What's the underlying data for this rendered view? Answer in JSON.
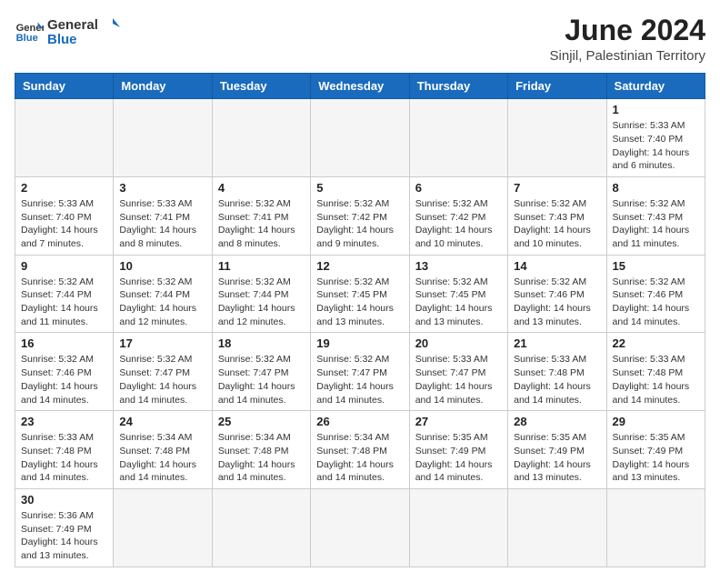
{
  "logo": {
    "text_general": "General",
    "text_blue": "Blue"
  },
  "title": {
    "month_year": "June 2024",
    "location": "Sinjil, Palestinian Territory"
  },
  "days_of_week": [
    "Sunday",
    "Monday",
    "Tuesday",
    "Wednesday",
    "Thursday",
    "Friday",
    "Saturday"
  ],
  "weeks": [
    [
      {
        "day": "",
        "info": ""
      },
      {
        "day": "",
        "info": ""
      },
      {
        "day": "",
        "info": ""
      },
      {
        "day": "",
        "info": ""
      },
      {
        "day": "",
        "info": ""
      },
      {
        "day": "",
        "info": ""
      },
      {
        "day": "1",
        "info": "Sunrise: 5:33 AM\nSunset: 7:40 PM\nDaylight: 14 hours\nand 6 minutes."
      }
    ],
    [
      {
        "day": "2",
        "info": "Sunrise: 5:33 AM\nSunset: 7:40 PM\nDaylight: 14 hours\nand 7 minutes."
      },
      {
        "day": "3",
        "info": "Sunrise: 5:33 AM\nSunset: 7:41 PM\nDaylight: 14 hours\nand 8 minutes."
      },
      {
        "day": "4",
        "info": "Sunrise: 5:32 AM\nSunset: 7:41 PM\nDaylight: 14 hours\nand 8 minutes."
      },
      {
        "day": "5",
        "info": "Sunrise: 5:32 AM\nSunset: 7:42 PM\nDaylight: 14 hours\nand 9 minutes."
      },
      {
        "day": "6",
        "info": "Sunrise: 5:32 AM\nSunset: 7:42 PM\nDaylight: 14 hours\nand 10 minutes."
      },
      {
        "day": "7",
        "info": "Sunrise: 5:32 AM\nSunset: 7:43 PM\nDaylight: 14 hours\nand 10 minutes."
      },
      {
        "day": "8",
        "info": "Sunrise: 5:32 AM\nSunset: 7:43 PM\nDaylight: 14 hours\nand 11 minutes."
      }
    ],
    [
      {
        "day": "9",
        "info": "Sunrise: 5:32 AM\nSunset: 7:44 PM\nDaylight: 14 hours\nand 11 minutes."
      },
      {
        "day": "10",
        "info": "Sunrise: 5:32 AM\nSunset: 7:44 PM\nDaylight: 14 hours\nand 12 minutes."
      },
      {
        "day": "11",
        "info": "Sunrise: 5:32 AM\nSunset: 7:44 PM\nDaylight: 14 hours\nand 12 minutes."
      },
      {
        "day": "12",
        "info": "Sunrise: 5:32 AM\nSunset: 7:45 PM\nDaylight: 14 hours\nand 13 minutes."
      },
      {
        "day": "13",
        "info": "Sunrise: 5:32 AM\nSunset: 7:45 PM\nDaylight: 14 hours\nand 13 minutes."
      },
      {
        "day": "14",
        "info": "Sunrise: 5:32 AM\nSunset: 7:46 PM\nDaylight: 14 hours\nand 13 minutes."
      },
      {
        "day": "15",
        "info": "Sunrise: 5:32 AM\nSunset: 7:46 PM\nDaylight: 14 hours\nand 14 minutes."
      }
    ],
    [
      {
        "day": "16",
        "info": "Sunrise: 5:32 AM\nSunset: 7:46 PM\nDaylight: 14 hours\nand 14 minutes."
      },
      {
        "day": "17",
        "info": "Sunrise: 5:32 AM\nSunset: 7:47 PM\nDaylight: 14 hours\nand 14 minutes."
      },
      {
        "day": "18",
        "info": "Sunrise: 5:32 AM\nSunset: 7:47 PM\nDaylight: 14 hours\nand 14 minutes."
      },
      {
        "day": "19",
        "info": "Sunrise: 5:32 AM\nSunset: 7:47 PM\nDaylight: 14 hours\nand 14 minutes."
      },
      {
        "day": "20",
        "info": "Sunrise: 5:33 AM\nSunset: 7:47 PM\nDaylight: 14 hours\nand 14 minutes."
      },
      {
        "day": "21",
        "info": "Sunrise: 5:33 AM\nSunset: 7:48 PM\nDaylight: 14 hours\nand 14 minutes."
      },
      {
        "day": "22",
        "info": "Sunrise: 5:33 AM\nSunset: 7:48 PM\nDaylight: 14 hours\nand 14 minutes."
      }
    ],
    [
      {
        "day": "23",
        "info": "Sunrise: 5:33 AM\nSunset: 7:48 PM\nDaylight: 14 hours\nand 14 minutes."
      },
      {
        "day": "24",
        "info": "Sunrise: 5:34 AM\nSunset: 7:48 PM\nDaylight: 14 hours\nand 14 minutes."
      },
      {
        "day": "25",
        "info": "Sunrise: 5:34 AM\nSunset: 7:48 PM\nDaylight: 14 hours\nand 14 minutes."
      },
      {
        "day": "26",
        "info": "Sunrise: 5:34 AM\nSunset: 7:48 PM\nDaylight: 14 hours\nand 14 minutes."
      },
      {
        "day": "27",
        "info": "Sunrise: 5:35 AM\nSunset: 7:49 PM\nDaylight: 14 hours\nand 14 minutes."
      },
      {
        "day": "28",
        "info": "Sunrise: 5:35 AM\nSunset: 7:49 PM\nDaylight: 14 hours\nand 13 minutes."
      },
      {
        "day": "29",
        "info": "Sunrise: 5:35 AM\nSunset: 7:49 PM\nDaylight: 14 hours\nand 13 minutes."
      }
    ],
    [
      {
        "day": "30",
        "info": "Sunrise: 5:36 AM\nSunset: 7:49 PM\nDaylight: 14 hours\nand 13 minutes."
      },
      {
        "day": "",
        "info": ""
      },
      {
        "day": "",
        "info": ""
      },
      {
        "day": "",
        "info": ""
      },
      {
        "day": "",
        "info": ""
      },
      {
        "day": "",
        "info": ""
      },
      {
        "day": "",
        "info": ""
      }
    ]
  ]
}
